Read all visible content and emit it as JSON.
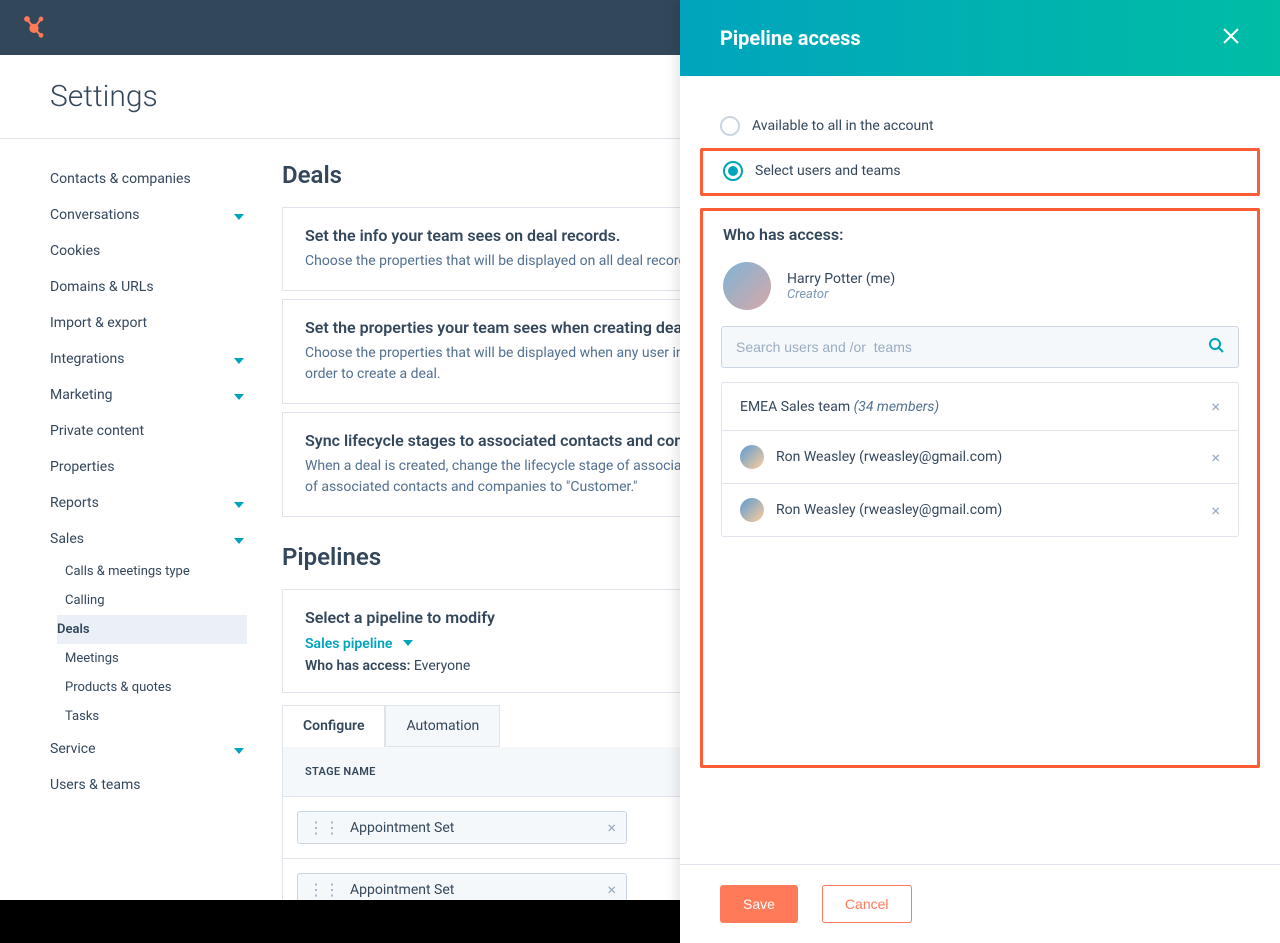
{
  "header": {
    "page_title": "Settings"
  },
  "sidebar": {
    "items": [
      {
        "label": "Contacts & companies",
        "chev": false
      },
      {
        "label": "Conversations",
        "chev": true
      },
      {
        "label": "Cookies",
        "chev": false
      },
      {
        "label": "Domains & URLs",
        "chev": false
      },
      {
        "label": "Import & export",
        "chev": false
      },
      {
        "label": "Integrations",
        "chev": true
      },
      {
        "label": "Marketing",
        "chev": true
      },
      {
        "label": "Private content",
        "chev": false
      },
      {
        "label": "Properties",
        "chev": false
      },
      {
        "label": "Reports",
        "chev": true
      },
      {
        "label": "Sales",
        "chev": true
      },
      {
        "label": "Service",
        "chev": true
      },
      {
        "label": "Users & teams",
        "chev": false
      }
    ],
    "sales_sub": [
      {
        "label": "Calls & meetings type"
      },
      {
        "label": "Calling"
      },
      {
        "label": "Deals",
        "active": true
      },
      {
        "label": "Meetings"
      },
      {
        "label": "Products & quotes"
      },
      {
        "label": "Tasks"
      }
    ]
  },
  "content": {
    "deals_title": "Deals",
    "cards": [
      {
        "title": "Set the info your team sees on deal records.",
        "desc": "Choose the properties that will be displayed on all deal records for all users in your HubSpot account."
      },
      {
        "title": "Set the properties your team sees when creating deals.",
        "desc": "Choose the properties that will be displayed when any user in your HubSpot account creates a deal. You can also choose which of these are required in order to create a deal."
      },
      {
        "title": "Sync lifecycle stages to associated contacts and companies",
        "desc": "When a deal is created, change the lifecycle stage of associated contacts and companies to \"Opportunity.\" When a deal is won, change the lifecycle stage of associated contacts and companies to \"Customer.\""
      }
    ],
    "pipelines_title": "Pipelines",
    "select_label": "Select a pipeline to modify",
    "pipeline_name": "Sales pipeline",
    "access_label": "Who has access:",
    "access_value": "Everyone",
    "tabs": {
      "configure": "Configure",
      "automation": "Automation"
    },
    "stage_header": "STAGE NAME",
    "stages": [
      {
        "name": "Appointment Set"
      },
      {
        "name": "Appointment Set"
      }
    ]
  },
  "panel": {
    "title": "Pipeline access",
    "radio_all": "Available to all in the account",
    "radio_select": "Select users and teams",
    "wha_title": "Who has access:",
    "creator": {
      "name": "Harry Potter (me)",
      "role": "Creator"
    },
    "search_placeholder": "Search users and /or  teams",
    "selected": [
      {
        "type": "team",
        "name": "EMEA Sales team",
        "meta": "(34 members)"
      },
      {
        "type": "user",
        "name": "Ron Weasley (rweasley@gmail.com)"
      },
      {
        "type": "user",
        "name": "Ron Weasley (rweasley@gmail.com)"
      }
    ],
    "save": "Save",
    "cancel": "Cancel"
  }
}
